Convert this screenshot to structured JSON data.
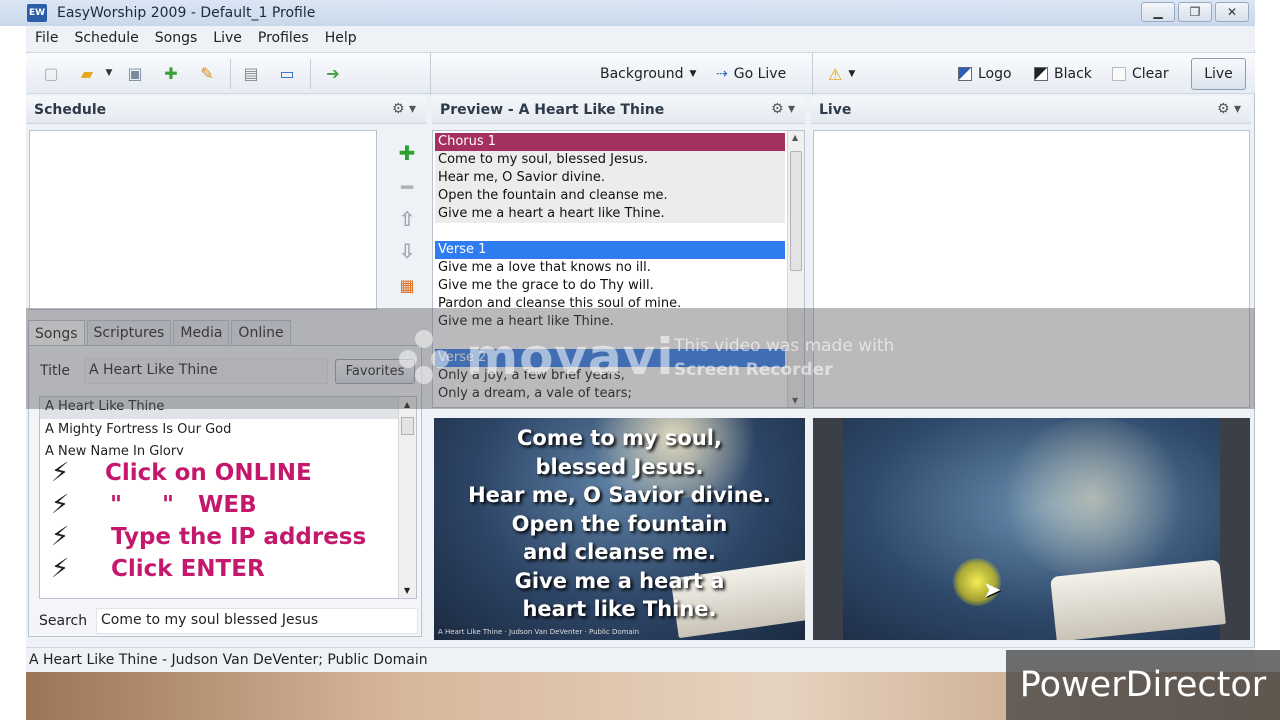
{
  "window": {
    "title": "EasyWorship 2009 - Default_1 Profile",
    "icon_text": "EW"
  },
  "menu": [
    "File",
    "Schedule",
    "Songs",
    "Live",
    "Profiles",
    "Help"
  ],
  "toolbar": {
    "background_label": "Background",
    "go_live_label": "Go Live",
    "logo_label": "Logo",
    "black_label": "Black",
    "clear_label": "Clear",
    "live_label": "Live"
  },
  "schedule": {
    "header": "Schedule"
  },
  "preview": {
    "header": "Preview - A Heart Like Thine",
    "sections": [
      {
        "name": "Chorus 1",
        "color": "#a3305f",
        "lines": [
          "Come to my soul, blessed Jesus.",
          "Hear me, O Savior divine.",
          "Open the fountain and cleanse me.",
          "Give me a heart a heart like Thine."
        ]
      },
      {
        "name": "Verse 1",
        "color": "#2f7cf0",
        "lines": [
          "Give me a love that knows no ill.",
          "Give me the grace to do Thy will.",
          "Pardon and cleanse this soul of mine.",
          "Give me a heart like Thine."
        ]
      },
      {
        "name": "Verse 2",
        "color": "#2f7cf0",
        "lines": [
          "Only a joy, a few brief years,",
          "Only a dream, a vale of tears;"
        ]
      }
    ]
  },
  "live": {
    "header": "Live"
  },
  "tabs": [
    "Songs",
    "Scriptures",
    "Media",
    "Online"
  ],
  "songs": {
    "title_label": "Title",
    "title_value": "A Heart Like Thine",
    "favorites_label": "Favorites",
    "list": [
      "A Heart Like Thine",
      "A Mighty Fortress Is Our God",
      "A New Name In Glory"
    ],
    "search_label": "Search",
    "search_value": "Come to my soul blessed Jesus"
  },
  "annotation": [
    {
      "bolt": "⚡",
      "text": "Click on ONLINE"
    },
    {
      "bolt": "⚡",
      "text": "\"     \"   WEB"
    },
    {
      "bolt": "⚡",
      "text": "Type the IP address"
    },
    {
      "bolt": "⚡",
      "text": "Click ENTER"
    }
  ],
  "preview_slide": {
    "lines": [
      "Come to my soul,",
      "blessed Jesus.",
      "Hear me, O Savior divine.",
      "Open the fountain",
      "and cleanse me.",
      "Give me a heart a",
      "heart like Thine."
    ],
    "caption": "A Heart Like Thine · Judson Van DeVenter · Public Domain"
  },
  "statusbar": "A Heart Like Thine - Judson Van DeVenter; Public Domain",
  "watermarks": {
    "movavi_word": "movavi",
    "movavi_line1": "This video was made with",
    "movavi_line2": "Screen Recorder",
    "powerdirector": "PowerDirector"
  },
  "colors": {
    "chorus": "#a3305f",
    "verse": "#2f7cf0",
    "annotation": "#c3186b"
  }
}
